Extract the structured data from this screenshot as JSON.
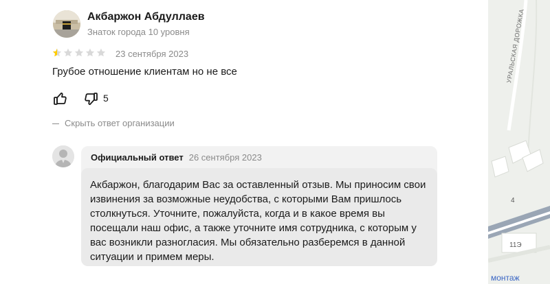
{
  "review": {
    "author_name": "Акбаржон Абдуллаев",
    "author_level": "Знаток города 10 уровня",
    "rating": 1,
    "rating_max": 5,
    "date": "23 сентября 2023",
    "text": "Грубое отношение клиентам но не все",
    "dislike_count": "5",
    "hide_answer_label": "Скрыть ответ организации"
  },
  "answer": {
    "title": "Официальный ответ",
    "date": "26 сентября 2023",
    "text": "Акбаржон, благодарим Вас за оставленный отзыв. Мы приносим свои извинения за возможные неудобства, с которыми Вам пришлось столкнуться. Уточните, пожалуйста, когда и в какое время вы посещали наш офис, а также уточните имя сотрудника, с которым у вас возникли разногласия. Мы обязательно разберемся в данной ситуации и примем меры."
  },
  "map": {
    "street_label": "УРАЛЬСКАЯ ДОРОЖКА",
    "house_number_1": "4",
    "house_number_2": "11Э",
    "bottom_label": "монтаж"
  },
  "colors": {
    "star_active": "#fc0",
    "star_inactive": "#d9d9d9",
    "muted_text": "#8a8a8a",
    "answer_bg": "#f2f2f2"
  }
}
